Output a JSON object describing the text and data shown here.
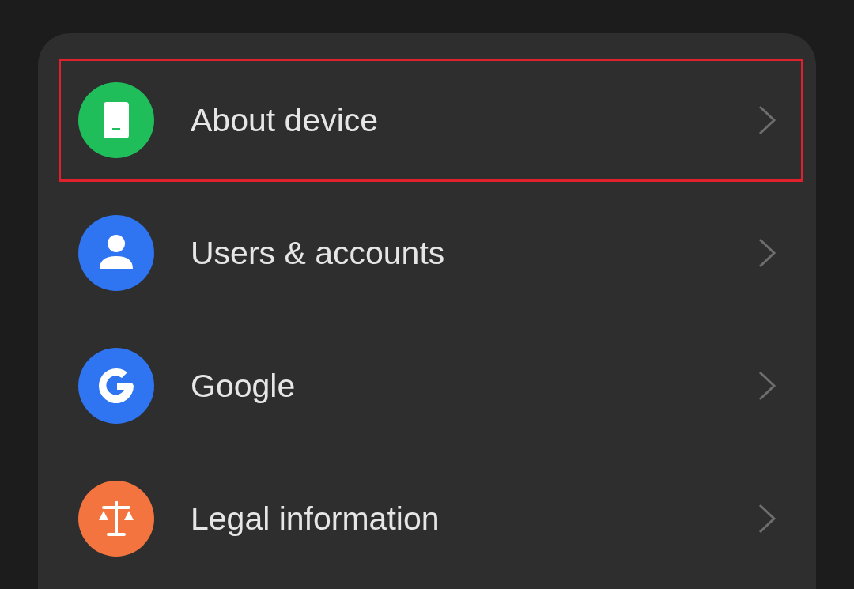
{
  "items": [
    {
      "label": "About device",
      "kind": "phone",
      "color": "#1fbe5a",
      "highlighted": true
    },
    {
      "label": "Users & accounts",
      "kind": "person",
      "color": "#2f74f0",
      "highlighted": false
    },
    {
      "label": "Google",
      "kind": "google",
      "color": "#2f74f0",
      "highlighted": false
    },
    {
      "label": "Legal information",
      "kind": "scales",
      "color": "#f4743f",
      "highlighted": false
    }
  ]
}
